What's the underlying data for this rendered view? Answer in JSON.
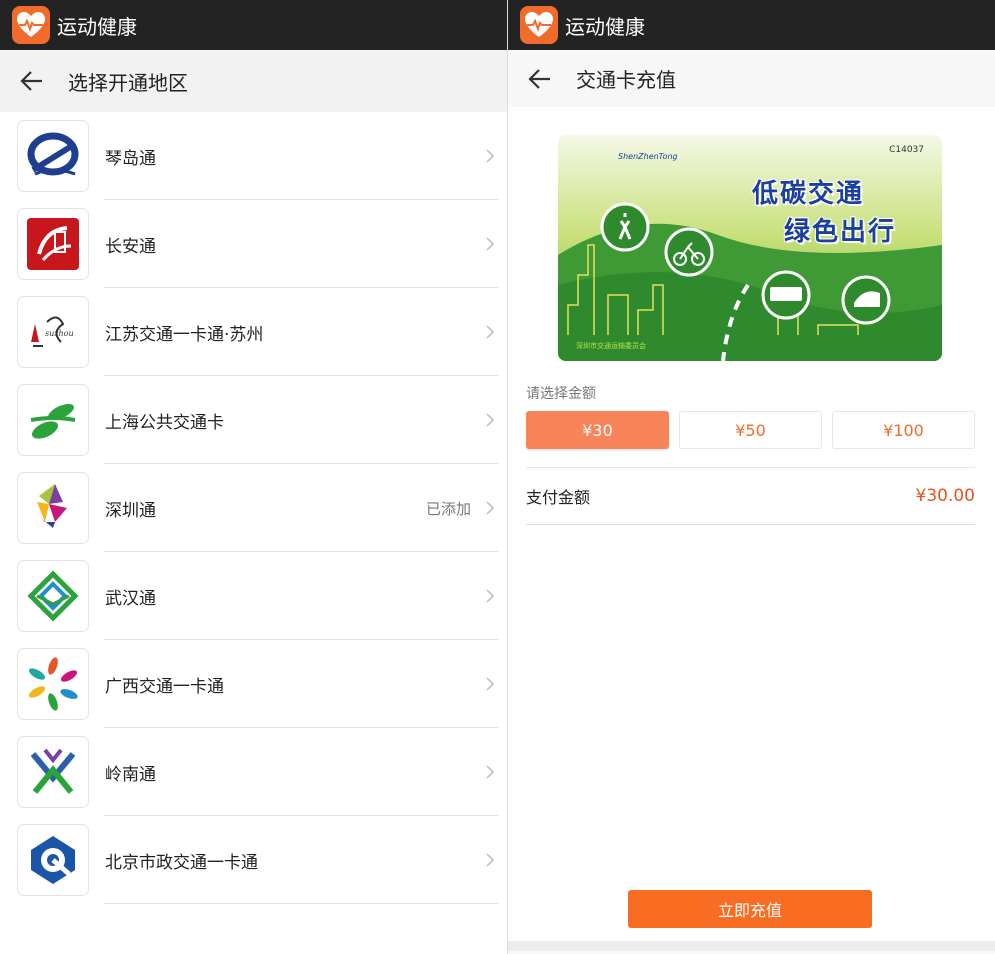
{
  "app": {
    "title": "运动健康"
  },
  "left": {
    "header": {
      "title": "选择开通地区"
    },
    "items": [
      {
        "label": "琴岛通",
        "status": "",
        "logo": "qindaotong-logo"
      },
      {
        "label": "长安通",
        "status": "",
        "logo": "changantong-logo"
      },
      {
        "label": "江苏交通一卡通·苏州",
        "status": "",
        "logo": "suzhou-citizen-card-logo"
      },
      {
        "label": "上海公共交通卡",
        "status": "",
        "logo": "shanghai-transport-card-logo"
      },
      {
        "label": "深圳通",
        "status": "已添加",
        "logo": "shenzhentong-logo"
      },
      {
        "label": "武汉通",
        "status": "",
        "logo": "wuhantong-logo"
      },
      {
        "label": "广西交通一卡通",
        "status": "",
        "logo": "guangxi-transport-card-logo"
      },
      {
        "label": "岭南通",
        "status": "",
        "logo": "lingnantong-logo"
      },
      {
        "label": "北京市政交通一卡通",
        "status": "",
        "logo": "beijing-transport-card-logo"
      }
    ]
  },
  "right": {
    "header": {
      "title": "交通卡充值"
    },
    "card": {
      "number": "C14037",
      "slogan_line1": "低碳交通",
      "slogan_line2": "绿色出行",
      "brand": "ShenZhenTong",
      "footer": "深圳市交通运输委员会"
    },
    "select_label": "请选择金额",
    "amounts": [
      "¥30",
      "¥50",
      "¥100"
    ],
    "selected_amount_index": 0,
    "pay_label": "支付金额",
    "pay_value": "¥30.00",
    "recharge_button": "立即充值"
  },
  "colors": {
    "accent": "#f96d23",
    "price": "#e9541c",
    "appbar": "#232323"
  }
}
